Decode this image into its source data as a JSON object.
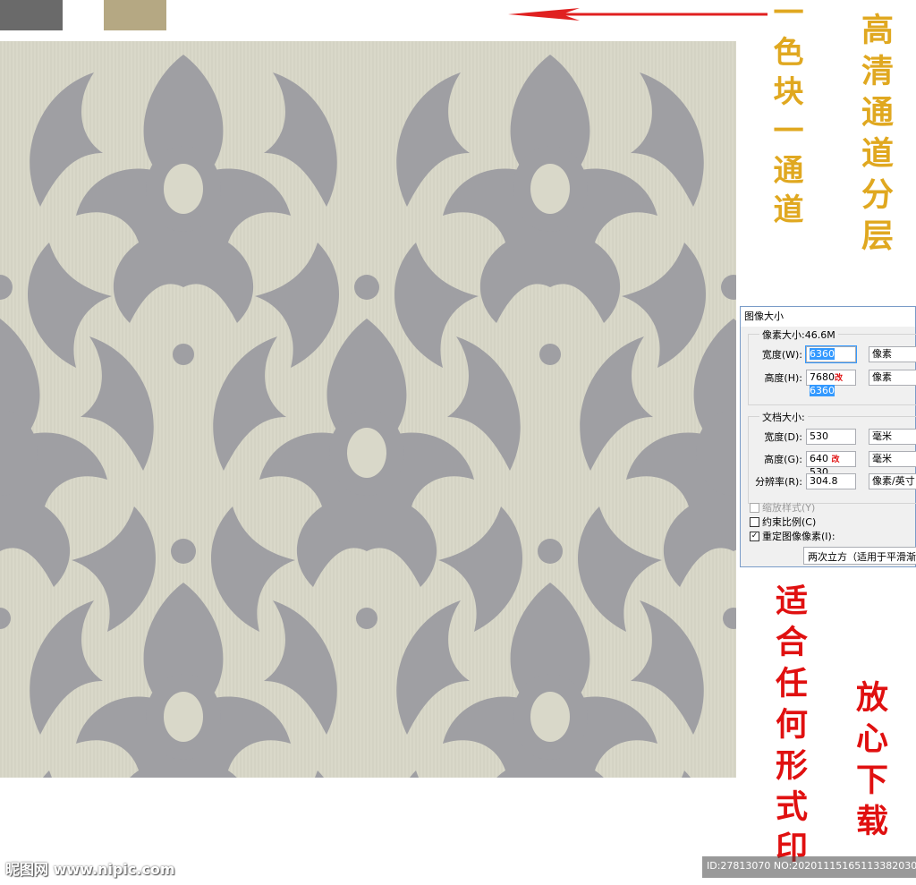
{
  "colors": {
    "swatch_gray": "#6a6a6a",
    "swatch_tan": "#b5a883",
    "pattern_background": "#d9d8c9",
    "pattern_motif": "#9f9fa3",
    "arrow": "#e02020",
    "text_gold": "#e0a820",
    "text_red": "#e01010"
  },
  "callouts": {
    "one_color_one_channel": "一色块一通道",
    "hd_channel_layers": "高清通道分层",
    "any_print_form": "适合任何形式印",
    "download_safely": "放心下载"
  },
  "dialog": {
    "title": "图像大小",
    "pixel_dimensions": {
      "heading": "像素大小:46.6M",
      "width_label": "宽度(W):",
      "width_value": "6360",
      "width_unit": "像素",
      "height_label": "高度(H):",
      "height_value_old": "7680",
      "height_value_mark": "改",
      "height_value_new": "6360",
      "height_unit": "像素"
    },
    "document_size": {
      "heading": "文档大小:",
      "width_label": "宽度(D):",
      "width_value": "530",
      "width_unit": "毫米",
      "height_label": "高度(G):",
      "height_value_old": "640",
      "height_value_mark": "改",
      "height_value_new": "530",
      "height_unit": "毫米",
      "resolution_label": "分辨率(R):",
      "resolution_value": "304.8",
      "resolution_unit": "像素/英寸"
    },
    "scale_styles_label": "缩放样式(Y)",
    "constrain_proportions_label": "约束比例(C)",
    "resample_label": "重定图像像素(I):",
    "resample_checked_mark": "✓",
    "resample_method": "两次立方（适用于平滑渐变"
  },
  "watermark": {
    "site": "昵图网 www.nipic.com",
    "id": "ID:27813070 NO:20201115165113382030"
  }
}
